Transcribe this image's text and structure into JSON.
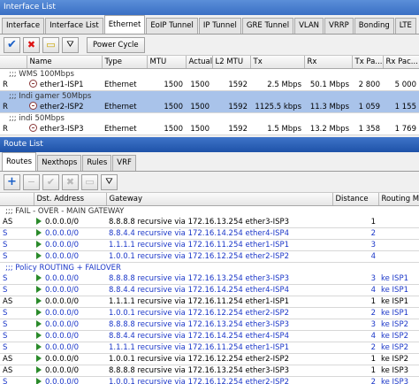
{
  "interface_window": {
    "title": "Interface List",
    "tabs": [
      "Interface",
      "Interface List",
      "Ethernet",
      "EoIP Tunnel",
      "IP Tunnel",
      "GRE Tunnel",
      "VLAN",
      "VRRP",
      "Bonding",
      "LTE"
    ],
    "active_tab": "Ethernet",
    "power_cycle_label": "Power Cycle",
    "columns": [
      "",
      "Name",
      "Type",
      "MTU",
      "Actual MTU",
      "L2 MTU",
      "Tx",
      "Rx",
      "Tx Pa...",
      "Rx Pac..."
    ],
    "rows": [
      {
        "kind": "comment",
        "text": ";;; WMS 100Mbps"
      },
      {
        "kind": "data",
        "flag": "R",
        "name": "ether1-ISP1",
        "type": "Ethernet",
        "mtu": "1500",
        "amtu": "1500",
        "l2mtu": "1592",
        "tx": "2.5 Mbps",
        "rx": "50.1 Mbps",
        "txp": "2 800",
        "rxp": "5 000"
      },
      {
        "kind": "comment",
        "text": ";;; Indi gamer 50Mbps",
        "selected": true
      },
      {
        "kind": "data",
        "flag": "R",
        "name": "ether2-ISP2",
        "type": "Ethernet",
        "mtu": "1500",
        "amtu": "1500",
        "l2mtu": "1592",
        "tx": "1125.5 kbps",
        "rx": "11.3 Mbps",
        "txp": "1 059",
        "rxp": "1 155",
        "selected": true
      },
      {
        "kind": "comment",
        "text": ";;; indi 50Mbps"
      },
      {
        "kind": "data",
        "flag": "R",
        "name": "ether3-ISP3",
        "type": "Ethernet",
        "mtu": "1500",
        "amtu": "1500",
        "l2mtu": "1592",
        "tx": "1.5 Mbps",
        "rx": "13.2 Mbps",
        "txp": "1 358",
        "rxp": "1 769"
      }
    ]
  },
  "route_window": {
    "title": "Route List",
    "tabs": [
      "Routes",
      "Nexthops",
      "Rules",
      "VRF"
    ],
    "active_tab": "Routes",
    "columns": [
      "",
      "Dst. Address",
      "Gateway",
      "Distance",
      "Routing M..."
    ],
    "rows": [
      {
        "kind": "comment",
        "text": ";;; FAIL - OVER - MAIN GATEWAY"
      },
      {
        "kind": "data",
        "flag": "AS",
        "dst": "0.0.0.0/0",
        "gw": "8.8.8.8 recursive via 172.16.13.254 ether3-ISP3",
        "dist": "1",
        "rm": "",
        "blue": false
      },
      {
        "kind": "data",
        "flag": "S",
        "dst": "0.0.0.0/0",
        "gw": "8.8.4.4 recursive via 172.16.14.254 ether4-ISP4",
        "dist": "2",
        "rm": "",
        "blue": true
      },
      {
        "kind": "data",
        "flag": "S",
        "dst": "0.0.0.0/0",
        "gw": "1.1.1.1 recursive via 172.16.11.254 ether1-ISP1",
        "dist": "3",
        "rm": "",
        "blue": true
      },
      {
        "kind": "data",
        "flag": "S",
        "dst": "0.0.0.0/0",
        "gw": "1.0.0.1 recursive via 172.16.12.254 ether2-ISP2",
        "dist": "4",
        "rm": "",
        "blue": true
      },
      {
        "kind": "comment",
        "text": ";;; Policy ROUTING + FAILOVER",
        "blue": true
      },
      {
        "kind": "data",
        "flag": "S",
        "dst": "0.0.0.0/0",
        "gw": "8.8.8.8 recursive via 172.16.13.254 ether3-ISP3",
        "dist": "3",
        "rm": "ke ISP1",
        "blue": true
      },
      {
        "kind": "data",
        "flag": "S",
        "dst": "0.0.0.0/0",
        "gw": "8.8.4.4 recursive via 172.16.14.254 ether4-ISP4",
        "dist": "4",
        "rm": "ke ISP1",
        "blue": true
      },
      {
        "kind": "data",
        "flag": "AS",
        "dst": "0.0.0.0/0",
        "gw": "1.1.1.1 recursive via 172.16.11.254 ether1-ISP1",
        "dist": "1",
        "rm": "ke ISP1",
        "blue": false
      },
      {
        "kind": "data",
        "flag": "S",
        "dst": "0.0.0.0/0",
        "gw": "1.0.0.1 recursive via 172.16.12.254 ether2-ISP2",
        "dist": "2",
        "rm": "ke ISP1",
        "blue": true
      },
      {
        "kind": "data",
        "flag": "S",
        "dst": "0.0.0.0/0",
        "gw": "8.8.8.8 recursive via 172.16.13.254 ether3-ISP3",
        "dist": "3",
        "rm": "ke ISP2",
        "blue": true
      },
      {
        "kind": "data",
        "flag": "S",
        "dst": "0.0.0.0/0",
        "gw": "8.8.4.4 recursive via 172.16.14.254 ether4-ISP4",
        "dist": "4",
        "rm": "ke ISP2",
        "blue": true
      },
      {
        "kind": "data",
        "flag": "S",
        "dst": "0.0.0.0/0",
        "gw": "1.1.1.1 recursive via 172.16.11.254 ether1-ISP1",
        "dist": "2",
        "rm": "ke ISP2",
        "blue": true
      },
      {
        "kind": "data",
        "flag": "AS",
        "dst": "0.0.0.0/0",
        "gw": "1.0.0.1 recursive via 172.16.12.254 ether2-ISP2",
        "dist": "1",
        "rm": "ke ISP2",
        "blue": false
      },
      {
        "kind": "data",
        "flag": "AS",
        "dst": "0.0.0.0/0",
        "gw": "8.8.8.8 recursive via 172.16.13.254 ether3-ISP3",
        "dist": "1",
        "rm": "ke ISP3",
        "blue": false
      },
      {
        "kind": "data",
        "flag": "S",
        "dst": "0.0.0.0/0",
        "gw": "1.0.0.1 recursive via 172.16.12.254 ether2-ISP2",
        "dist": "2",
        "rm": "ke ISP3",
        "blue": true
      }
    ]
  },
  "colors": {
    "selection": "#a9c3ea",
    "blue_text": "#1a36c8",
    "titlebar": "#3a6fc4"
  }
}
